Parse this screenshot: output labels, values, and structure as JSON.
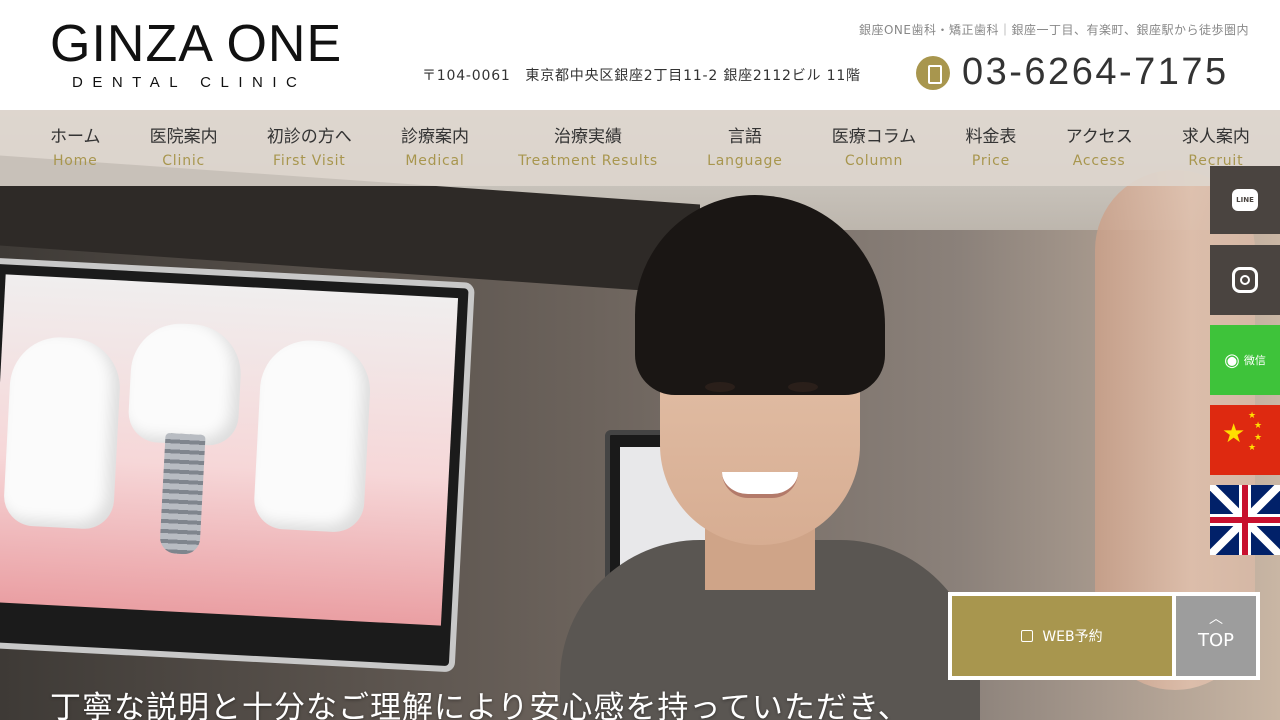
{
  "header": {
    "logo_main": "GINZA ONE",
    "logo_sub": "DENTAL CLINIC",
    "tagline": "銀座ONE歯科・矯正歯科｜銀座一丁目、有楽町、銀座駅から徒歩圏内",
    "address": "〒104-0061　東京都中央区銀座2丁目11-2 銀座2112ビル 11階",
    "phone": "03-6264-7175",
    "phone_icon": "phone-icon",
    "accent_color": "#a8964e"
  },
  "nav": [
    {
      "jp": "ホーム",
      "en": "Home"
    },
    {
      "jp": "医院案内",
      "en": "Clinic"
    },
    {
      "jp": "初診の方へ",
      "en": "First Visit"
    },
    {
      "jp": "診療案内",
      "en": "Medical"
    },
    {
      "jp": "治療実績",
      "en": "Treatment Results"
    },
    {
      "jp": "言語",
      "en": "Language"
    },
    {
      "jp": "医療コラム",
      "en": "Column"
    },
    {
      "jp": "料金表",
      "en": "Price"
    },
    {
      "jp": "アクセス",
      "en": "Access"
    },
    {
      "jp": "求人案内",
      "en": "Recruit"
    }
  ],
  "side_buttons": {
    "line": "LINE",
    "wechat": "微信"
  },
  "cta": {
    "web_reserve": "WEB予約",
    "top": "TOP"
  },
  "hero": {
    "caption": "丁寧な説明と十分なご理解により安心感を持っていただき、"
  }
}
